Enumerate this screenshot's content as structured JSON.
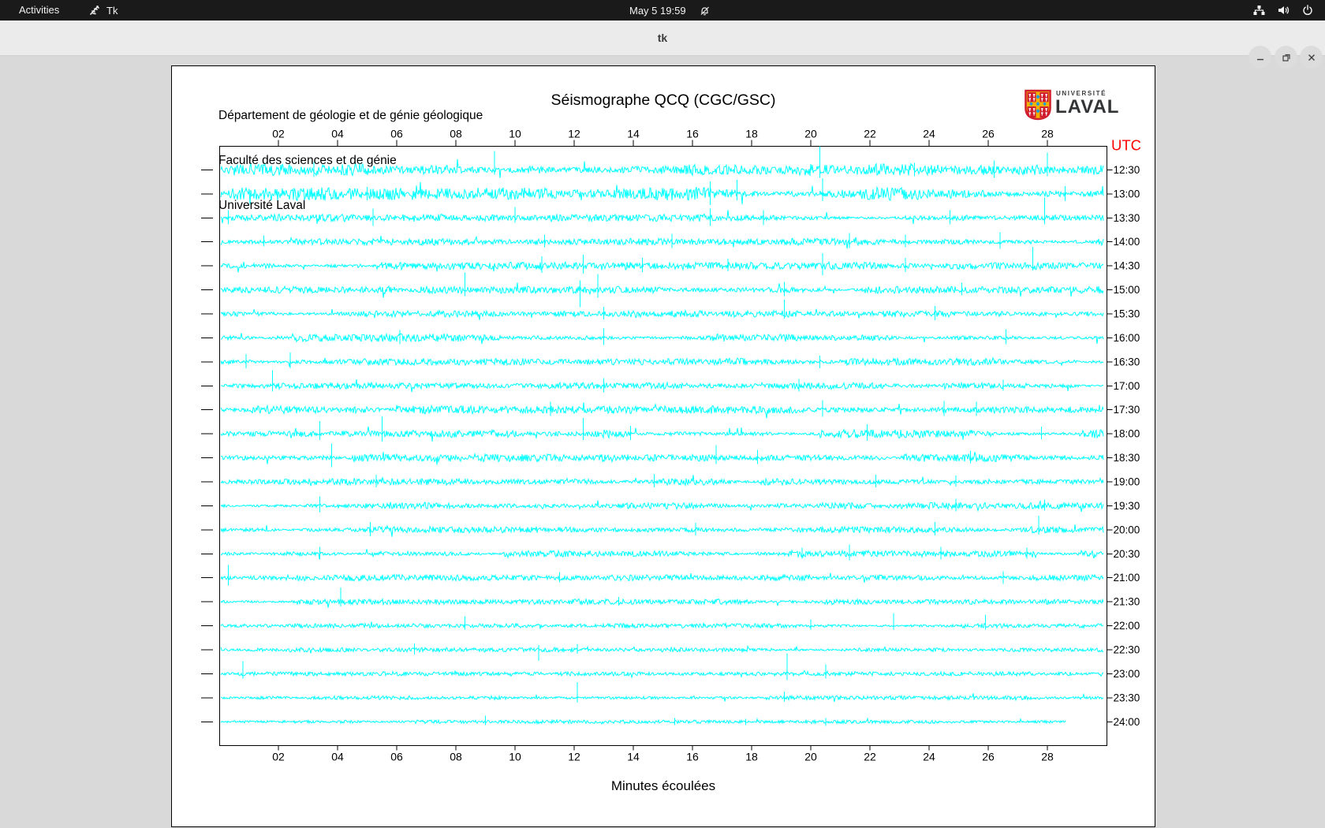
{
  "topbar": {
    "activities": "Activities",
    "app_name": "Tk",
    "clock": "May 5  19:59"
  },
  "titlebar": {
    "title": "tk"
  },
  "icons": {
    "topbar": [
      "tk-icon",
      "bell-muted-icon",
      "network-wired-icon",
      "volume-icon",
      "power-icon"
    ],
    "window": [
      "minimize-icon",
      "restore-icon",
      "close-icon"
    ]
  },
  "canvas": {
    "header_lines": [
      "Département de géologie et de génie géologique",
      "Faculté des sciences et de génie",
      "Université Laval"
    ],
    "title": "Séismographe QCQ (CGC/GSC)",
    "logo": {
      "small": "UNIVERSITÉ",
      "large": "LAVAL"
    },
    "utc_label": "UTC",
    "xlabel": "Minutes écoulées"
  },
  "colors": {
    "trace": "#00ffff",
    "utc_label": "#ff0000",
    "axis": "#000000",
    "logo_red": "#d01e2f",
    "logo_gold": "#f2b202",
    "logo_blue": "#1f9bdb"
  },
  "chart_data": {
    "type": "line",
    "title": "Séismographe QCQ (CGC/GSC)",
    "xlabel": "Minutes écoulées",
    "ylabel": "UTC",
    "x_range_minutes": [
      0,
      30
    ],
    "x_tick_labels": [
      "02",
      "04",
      "06",
      "08",
      "10",
      "12",
      "14",
      "16",
      "18",
      "20",
      "22",
      "24",
      "26",
      "28"
    ],
    "grid": false,
    "legend": false,
    "rows": [
      {
        "utc": "12:30",
        "amp": 4.2,
        "end": 29.9,
        "spikes": [
          [
            3.2,
            10,
            9
          ],
          [
            9.3,
            24,
            6
          ],
          [
            20.3,
            30,
            10
          ],
          [
            23.5,
            9,
            8
          ],
          [
            26.2,
            12,
            10
          ],
          [
            28.0,
            22,
            8
          ]
        ]
      },
      {
        "utc": "13:00",
        "amp": 4.5,
        "end": 29.9,
        "spikes": [
          [
            5.0,
            9,
            8
          ],
          [
            16.6,
            16,
            14
          ],
          [
            17.5,
            18,
            8
          ],
          [
            20.4,
            20,
            9
          ],
          [
            28.6,
            10,
            9
          ]
        ]
      },
      {
        "utc": "13:30",
        "amp": 2.6,
        "end": 29.9,
        "spikes": [
          [
            0.3,
            10,
            8
          ],
          [
            5.2,
            12,
            10
          ],
          [
            10.0,
            14,
            6
          ],
          [
            16.6,
            12,
            10
          ],
          [
            18.4,
            10,
            9
          ],
          [
            24.7,
            10,
            8
          ],
          [
            27.9,
            26,
            8
          ]
        ]
      },
      {
        "utc": "14:00",
        "amp": 2.4,
        "end": 29.9,
        "spikes": [
          [
            1.5,
            8,
            6
          ],
          [
            11.0,
            9,
            7
          ],
          [
            15.3,
            10,
            8
          ],
          [
            21.3,
            11,
            8
          ],
          [
            23.2,
            9,
            7
          ],
          [
            26.4,
            12,
            9
          ]
        ]
      },
      {
        "utc": "14:30",
        "amp": 2.6,
        "end": 29.9,
        "spikes": [
          [
            10.9,
            12,
            9
          ],
          [
            12.3,
            14,
            10
          ],
          [
            14.3,
            10,
            8
          ],
          [
            17.2,
            9,
            7
          ],
          [
            20.4,
            16,
            12
          ],
          [
            23.2,
            10,
            8
          ],
          [
            27.5,
            24,
            6
          ]
        ]
      },
      {
        "utc": "15:00",
        "amp": 2.5,
        "end": 29.9,
        "spikes": [
          [
            8.3,
            22,
            8
          ],
          [
            12.2,
            12,
            22
          ],
          [
            12.8,
            20,
            10
          ],
          [
            19.1,
            10,
            8
          ],
          [
            25.1,
            9,
            7
          ]
        ]
      },
      {
        "utc": "15:30",
        "amp": 2.3,
        "end": 29.9,
        "spikes": [
          [
            13.0,
            9,
            7
          ],
          [
            19.1,
            18,
            6
          ],
          [
            24.2,
            10,
            8
          ]
        ]
      },
      {
        "utc": "16:00",
        "amp": 2.8,
        "end": 29.9,
        "spikes": [
          [
            6.1,
            10,
            8
          ],
          [
            13.0,
            12,
            9
          ],
          [
            26.6,
            11,
            8
          ]
        ]
      },
      {
        "utc": "16:30",
        "amp": 2.6,
        "end": 29.9,
        "spikes": [
          [
            0.9,
            10,
            8
          ],
          [
            2.4,
            12,
            8
          ],
          [
            20.3,
            8,
            8
          ]
        ]
      },
      {
        "utc": "17:00",
        "amp": 2.2,
        "end": 29.9,
        "spikes": [
          [
            1.8,
            20,
            7
          ],
          [
            13.0,
            10,
            8
          ],
          [
            19.6,
            9,
            7
          ],
          [
            26.5,
            8,
            6
          ]
        ]
      },
      {
        "utc": "17:30",
        "amp": 2.8,
        "end": 29.9,
        "spikes": [
          [
            11.2,
            10,
            8
          ],
          [
            20.4,
            12,
            9
          ],
          [
            24.5,
            11,
            8
          ],
          [
            25.6,
            10,
            8
          ]
        ]
      },
      {
        "utc": "18:00",
        "amp": 2.9,
        "end": 29.9,
        "spikes": [
          [
            3.4,
            16,
            8
          ],
          [
            5.5,
            22,
            10
          ],
          [
            12.3,
            20,
            8
          ],
          [
            13.9,
            10,
            8
          ],
          [
            21.9,
            12,
            9
          ],
          [
            27.8,
            9,
            7
          ]
        ]
      },
      {
        "utc": "18:30",
        "amp": 2.7,
        "end": 29.9,
        "spikes": [
          [
            3.8,
            18,
            12
          ],
          [
            16.8,
            16,
            8
          ],
          [
            18.2,
            10,
            8
          ],
          [
            25.4,
            9,
            7
          ]
        ]
      },
      {
        "utc": "19:00",
        "amp": 2.3,
        "end": 29.9,
        "spikes": [
          [
            5.3,
            9,
            7
          ],
          [
            14.7,
            10,
            7
          ],
          [
            22.2,
            9,
            7
          ],
          [
            24.9,
            8,
            6
          ]
        ]
      },
      {
        "utc": "19:30",
        "amp": 2.2,
        "end": 29.9,
        "spikes": [
          [
            3.4,
            12,
            8
          ],
          [
            24.9,
            9,
            7
          ],
          [
            27.9,
            8,
            6
          ]
        ]
      },
      {
        "utc": "20:00",
        "amp": 2.3,
        "end": 29.9,
        "spikes": [
          [
            5.1,
            10,
            8
          ],
          [
            16.1,
            9,
            7
          ],
          [
            24.2,
            10,
            7
          ],
          [
            27.7,
            18,
            6
          ]
        ]
      },
      {
        "utc": "20:30",
        "amp": 2.2,
        "end": 29.9,
        "spikes": [
          [
            3.4,
            9,
            7
          ],
          [
            19.7,
            8,
            6
          ],
          [
            21.3,
            12,
            8
          ],
          [
            24.4,
            9,
            7
          ],
          [
            27.3,
            8,
            6
          ]
        ]
      },
      {
        "utc": "21:00",
        "amp": 2.1,
        "end": 29.9,
        "spikes": [
          [
            0.3,
            16,
            10
          ],
          [
            11.5,
            7,
            6
          ],
          [
            26.5,
            8,
            8
          ]
        ]
      },
      {
        "utc": "21:30",
        "amp": 1.9,
        "end": 29.9,
        "spikes": [
          [
            4.1,
            18,
            6
          ],
          [
            13.5,
            6,
            5
          ]
        ]
      },
      {
        "utc": "22:00",
        "amp": 1.6,
        "end": 29.9,
        "spikes": [
          [
            8.3,
            12,
            5
          ],
          [
            20.0,
            8,
            5
          ],
          [
            22.8,
            16,
            5
          ],
          [
            25.9,
            14,
            5
          ]
        ]
      },
      {
        "utc": "22:30",
        "amp": 1.5,
        "end": 29.9,
        "spikes": [
          [
            6.6,
            8,
            6
          ],
          [
            10.8,
            6,
            14
          ],
          [
            12.1,
            7,
            5
          ]
        ]
      },
      {
        "utc": "23:00",
        "amp": 1.5,
        "end": 29.9,
        "spikes": [
          [
            0.8,
            16,
            6
          ],
          [
            19.2,
            26,
            8
          ],
          [
            20.5,
            12,
            6
          ]
        ]
      },
      {
        "utc": "23:30",
        "amp": 1.4,
        "end": 29.9,
        "spikes": [
          [
            12.1,
            20,
            6
          ],
          [
            19.1,
            8,
            5
          ]
        ]
      },
      {
        "utc": "24:00",
        "amp": 1.2,
        "end": 28.6,
        "spikes": [
          [
            9.0,
            8,
            4
          ],
          [
            15.4,
            5,
            4
          ],
          [
            17.8,
            4,
            4
          ],
          [
            20.5,
            5,
            5
          ]
        ]
      }
    ]
  }
}
